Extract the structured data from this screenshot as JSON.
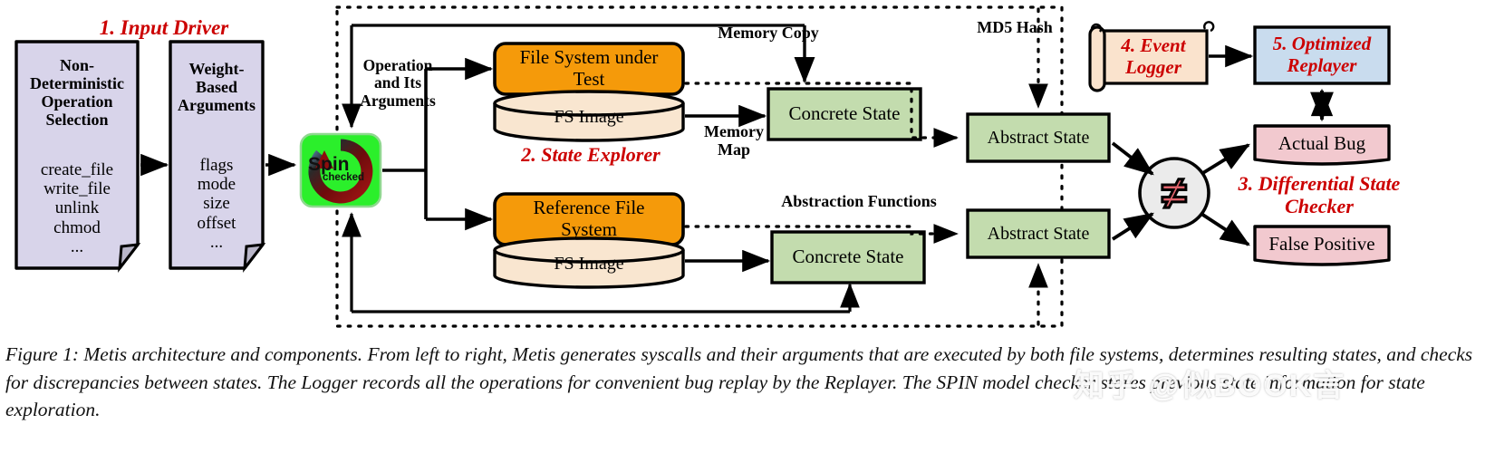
{
  "figure": {
    "caption": "Figure 1: Metis architecture and components. From left to right, Metis generates syscalls and their arguments that are executed by both file systems, determines resulting states, and checks for discrepancies between states.  The Logger records all the operations for convenient bug replay by the Replayer. The SPIN model checker stores previous state information for state exploration.",
    "watermark": "知乎 @似BOOK言"
  },
  "stage_titles": {
    "input_driver": "1. Input Driver",
    "state_explorer": "2. State Explorer",
    "differential_state_checker": "3. Differential State\nChecker",
    "event_logger": "4. Event\nLogger",
    "optimized_replayer": "5. Optimized\nReplayer"
  },
  "nodes": {
    "nondet": {
      "title": "Non-\nDeterministic\nOperation\nSelection",
      "items": "create_file\nwrite_file\nunlink\nchmod\n..."
    },
    "weights": {
      "title": "Weight-\nBased\nArguments",
      "items": "flags\nmode\nsize\noffset\n..."
    },
    "spin": {
      "logo_top": "Spin",
      "logo_bottom": "checked"
    },
    "fs_under_test": "File System under\nTest",
    "fs_image_top": "FS Image",
    "reference_fs": "Reference File\nSystem",
    "fs_image_bottom": "FS Image",
    "concrete_state_top": "Concrete State",
    "concrete_state_bottom": "Concrete State",
    "abstract_state_top": "Abstract State",
    "abstract_state_bottom": "Abstract State",
    "actual_bug": "Actual Bug",
    "false_positive": "False Positive",
    "neq_symbol": "≠"
  },
  "edge_labels": {
    "operation_and_args": "Operation\nand Its\nArguments",
    "memory_copy": "Memory Copy",
    "memory_map": "Memory\nMap",
    "md5_hash": "MD5 Hash",
    "abstraction_functions": "Abstraction Functions"
  },
  "colors": {
    "accent_red": "#cc0000",
    "document_lavender": "#d8d4ea",
    "orange_box": "#f59a0a",
    "cylinder_cream": "#f9e6d0",
    "green_state": "#c3dcae",
    "pink_result": "#f2c9cf",
    "blue_replayer": "#c9dcee",
    "scroll_cream": "#fae3cd",
    "spin_green": "#2bef2b",
    "spin_arrow_red": "#8e0d0d",
    "neq_circle": "#ebebeb",
    "neq_glyph": "#e2636c",
    "stroke": "#000000"
  }
}
